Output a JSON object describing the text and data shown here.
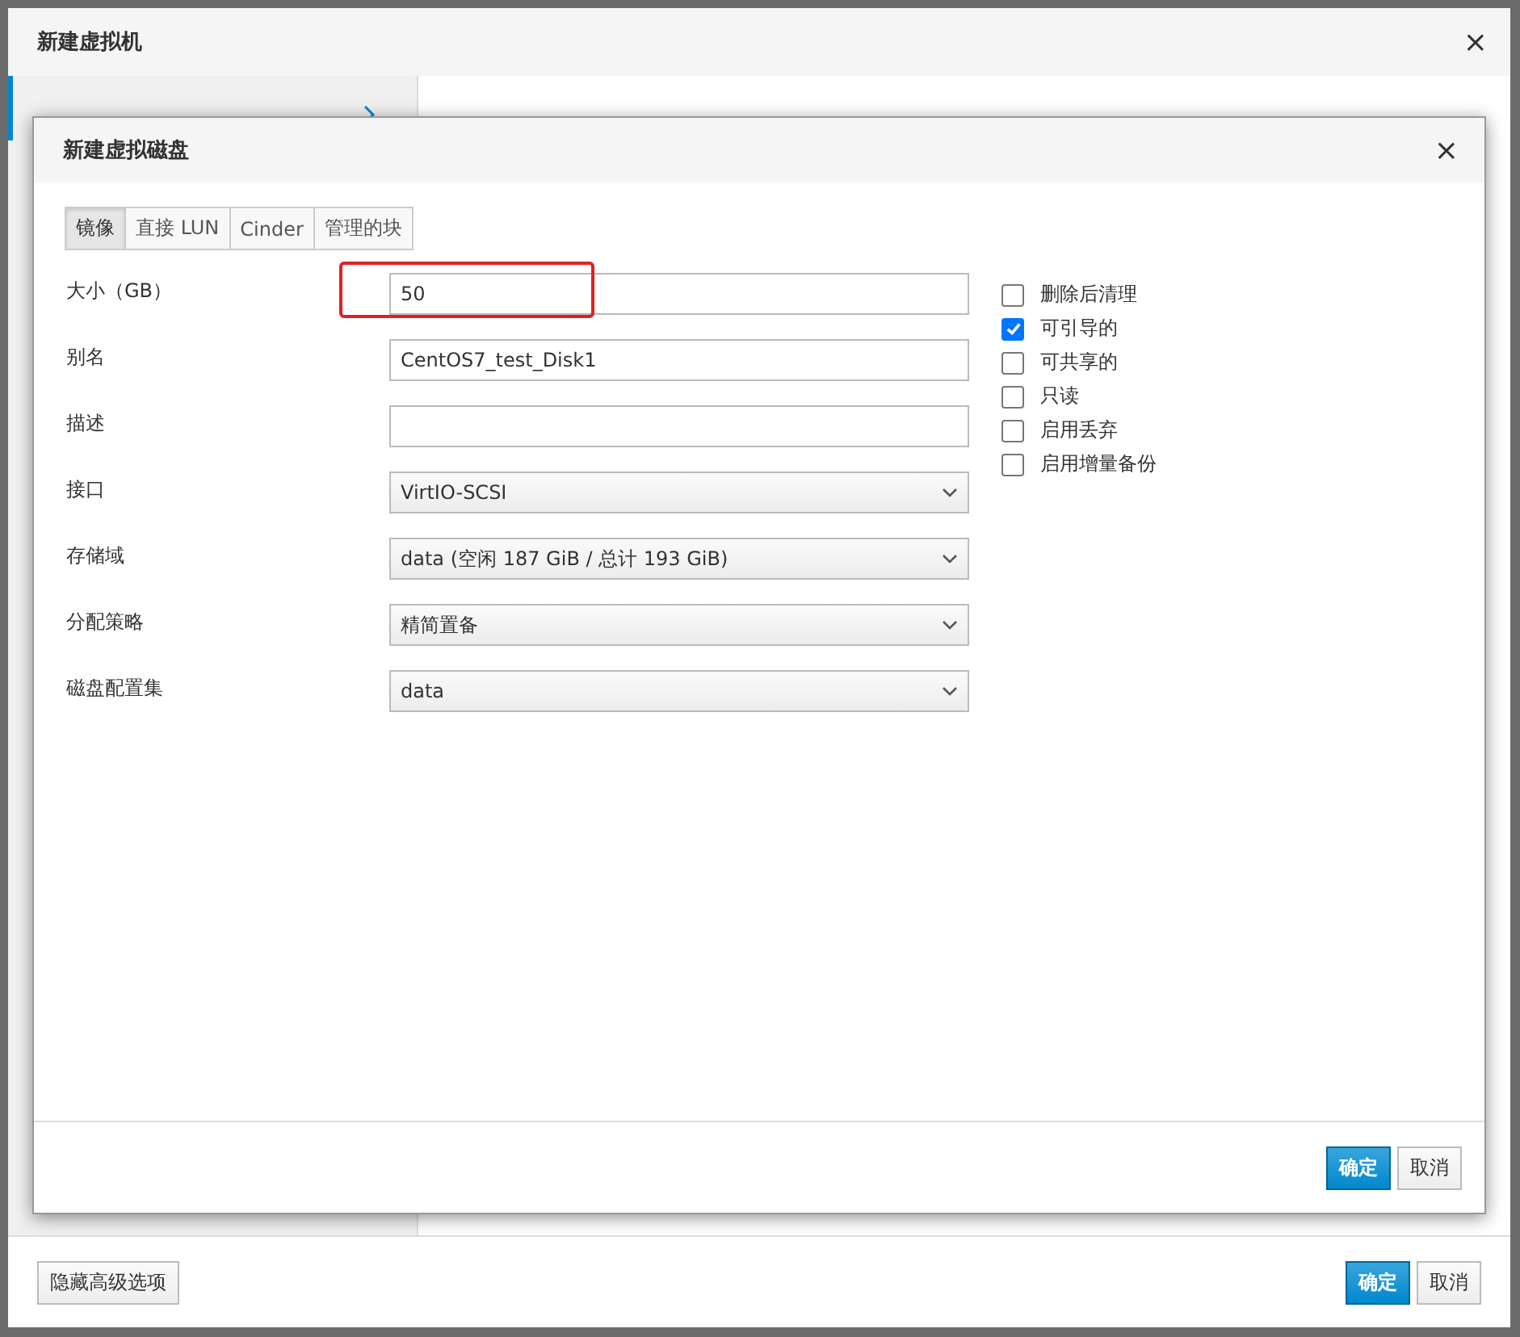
{
  "vm_dialog": {
    "title": "新建虚拟机",
    "close": "×",
    "sidebar": {
      "items": [
        {
          "selected": true
        }
      ]
    },
    "footer_buttons": [
      {
        "label": "隐藏高级选项",
        "kind": "default"
      },
      {
        "label": "确定",
        "kind": "primary"
      },
      {
        "label": "取消",
        "kind": "default"
      }
    ]
  },
  "disk_dialog": {
    "title": "新建虚拟磁盘",
    "close": "×",
    "tabs": [
      {
        "label": "镜像",
        "selected": true
      },
      {
        "label": "直接 LUN",
        "selected": false
      },
      {
        "label": "Cinder",
        "selected": false
      },
      {
        "label": "管理的块",
        "selected": false
      }
    ],
    "fields": [
      {
        "label": "大小（GB）",
        "kind": "text",
        "value": "50",
        "highlighted": true
      },
      {
        "label": "别名",
        "kind": "text",
        "value": "CentOS7_test_Disk1",
        "highlighted": false
      },
      {
        "label": "描述",
        "kind": "text",
        "highlighted": false
      },
      {
        "label": "接口",
        "kind": "select",
        "value": "VirtIO-SCSI",
        "highlighted": false
      },
      {
        "label": "存储域",
        "kind": "select",
        "value": "data (空闲 187 GiB / 总计 193 GiB)",
        "highlighted": false
      },
      {
        "label": "分配策略",
        "kind": "select",
        "value": "精简置备",
        "highlighted": false
      },
      {
        "label": "磁盘配置集",
        "kind": "select",
        "value": "data",
        "highlighted": false
      }
    ],
    "checkboxes": [
      {
        "label": "删除后清理",
        "checked": false
      },
      {
        "label": "可引导的",
        "checked": true
      },
      {
        "label": "可共享的",
        "checked": false
      },
      {
        "label": "只读",
        "checked": false
      },
      {
        "label": "启用丢弃",
        "checked": false
      },
      {
        "label": "启用增量备份",
        "checked": false
      }
    ],
    "buttons": [
      {
        "label": "确定",
        "kind": "primary"
      },
      {
        "label": "取消",
        "kind": "default"
      }
    ]
  }
}
